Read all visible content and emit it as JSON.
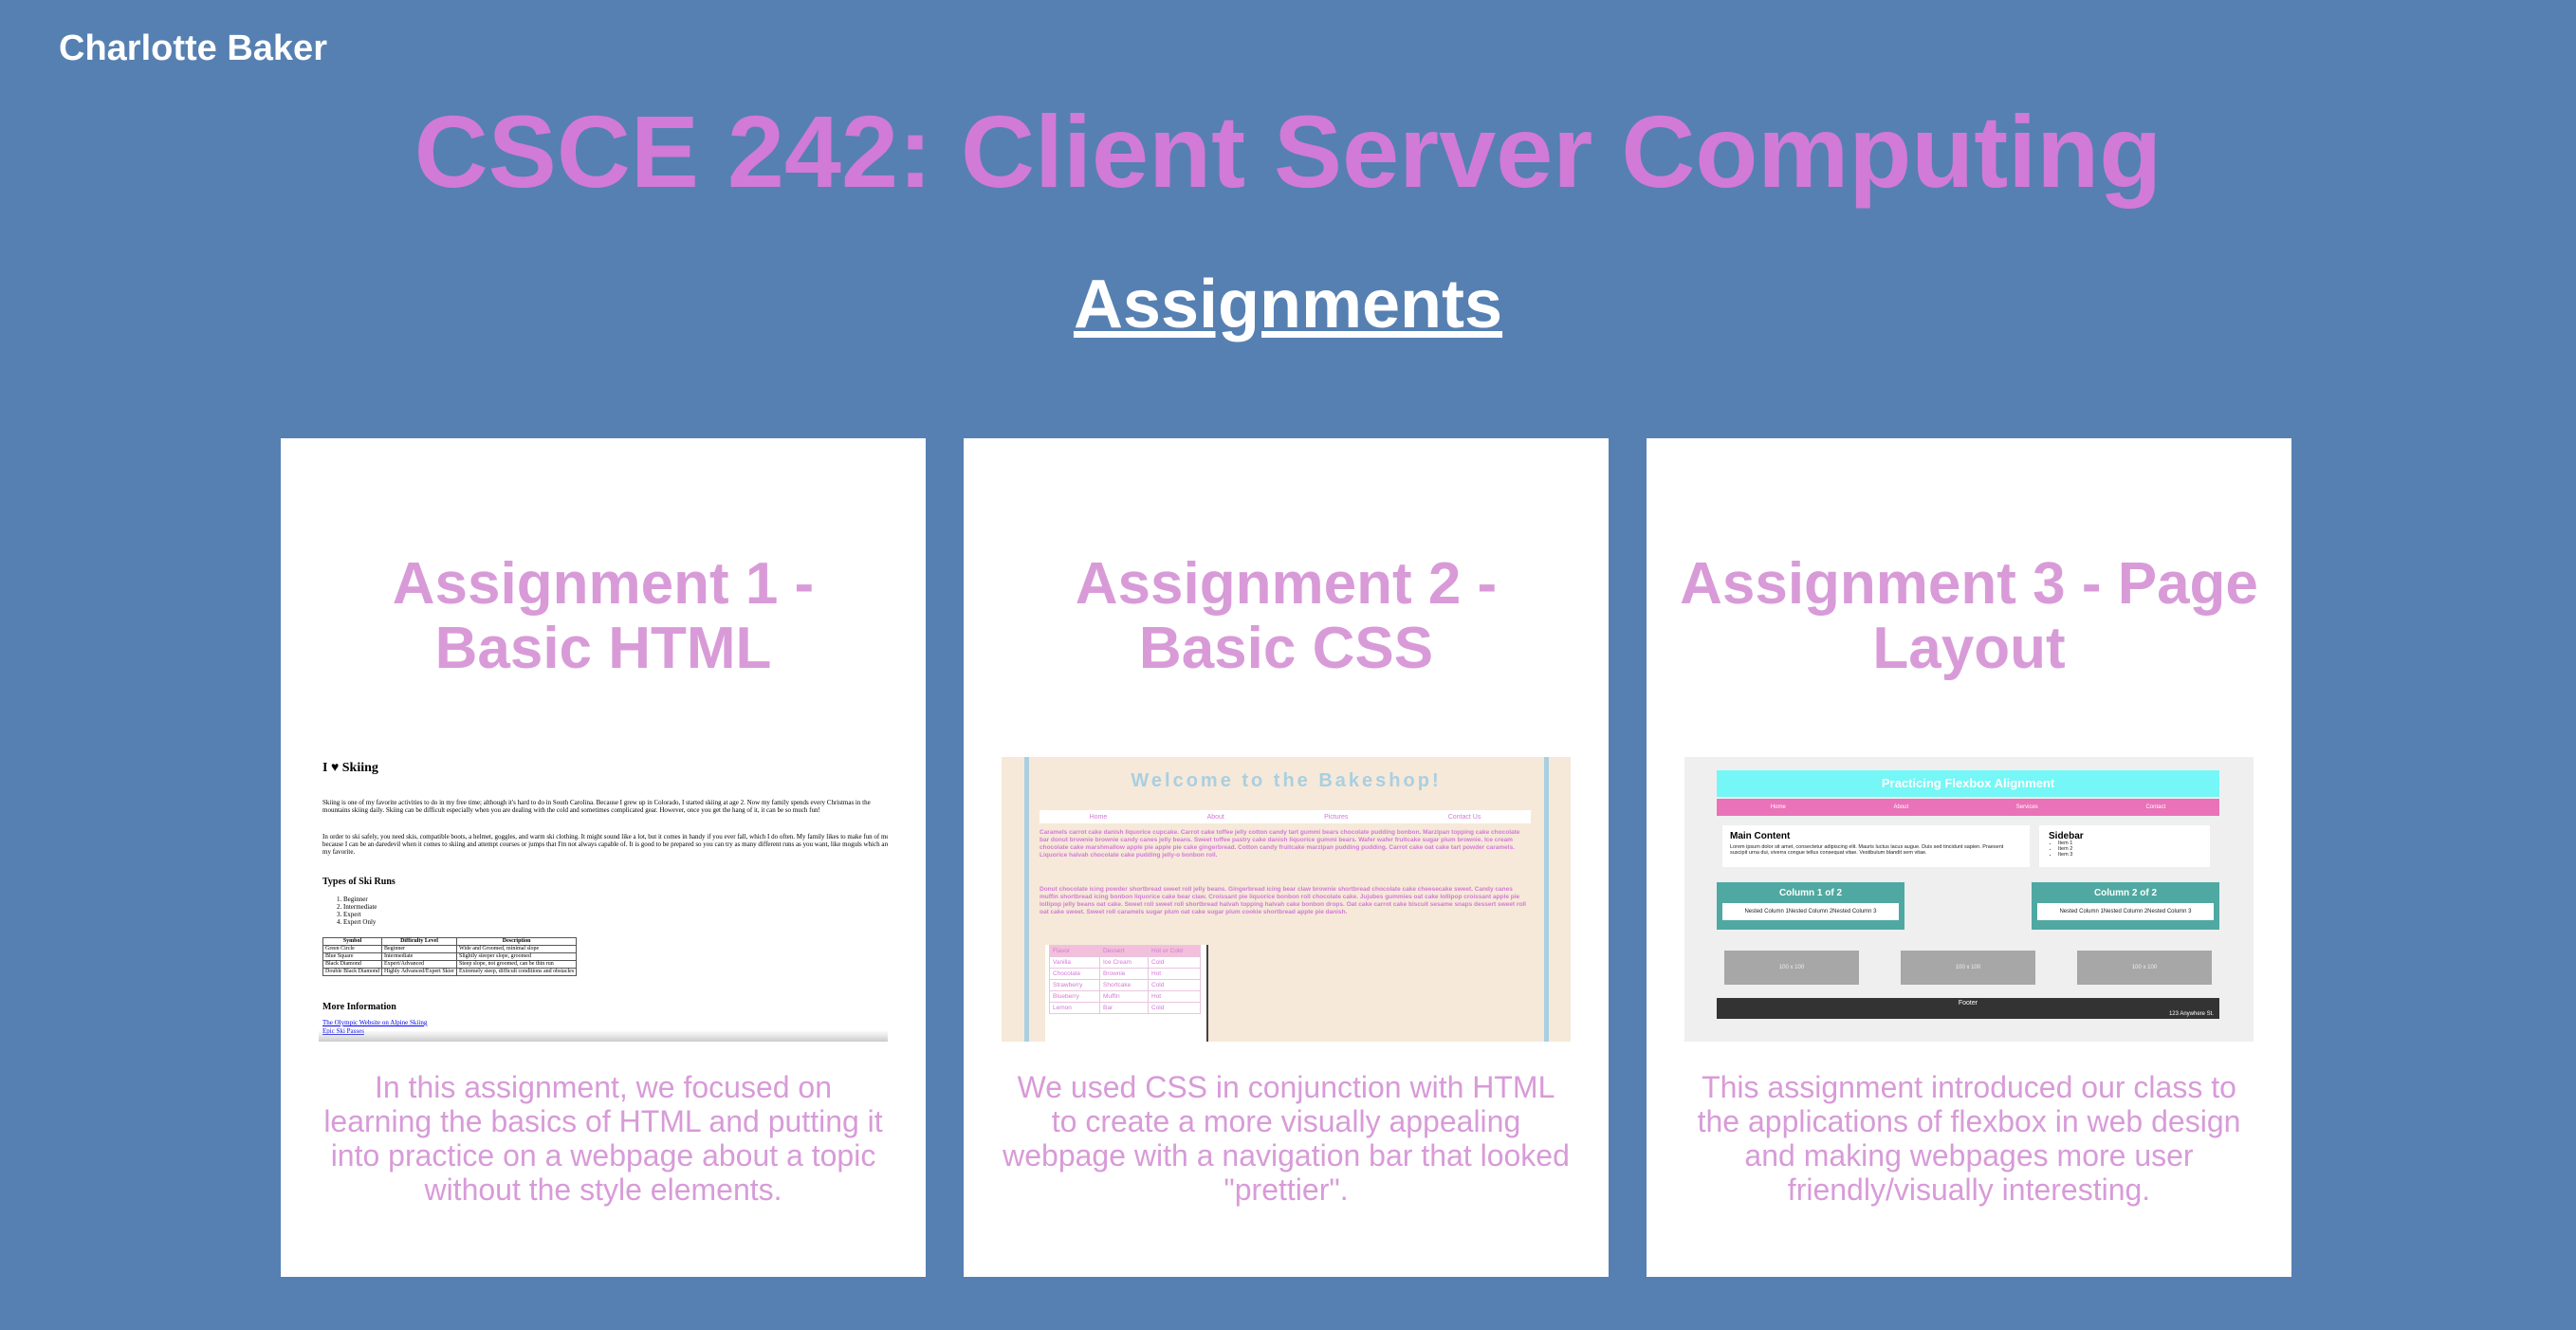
{
  "header": {
    "author": "Charlotte Baker",
    "course_title": "CSCE 242: Client Server Computing",
    "section_title": "Assignments"
  },
  "cards": [
    {
      "title": "Assignment 1 - Basic HTML",
      "description": "In this assignment, we focused on learning the basics of HTML and putting it into practice on a webpage about a topic without the style elements.",
      "preview": {
        "heading": "I ♥ Skiing",
        "para1": "Skiing is one of my favorite activities to do in my free time; although it's hard to do in South Carolina. Because I grew up in Colorado, I started skiing at age 2. Now my family spends every Christmas in the mountains skiing daily. Skiing can be difficult especially when you are dealing with the cold and sometimes complicated gear. However, once you get the hang of it, it can be so much fun!",
        "para2": "In order to ski safely, you need skis, compatible boots, a helmet, goggles, and warm ski clothing. It might sound like a lot, but it comes in handy if you ever fall, which I do often. My family likes to make fun of me because I can be an daredevil when it comes to skiing and attempt courses or jumps that I'm not always capable of. It is good to be prepared so you can try as many different runs as you want, like moguls which are my favorite.",
        "runs_heading": "Types of Ski Runs",
        "runs": [
          "Beginner",
          "Intermediate",
          "Expert",
          "Expert Only"
        ],
        "table_headers": [
          "Symbol",
          "Difficulty Level",
          "Description"
        ],
        "table_rows": [
          [
            "Green Circle",
            "Beginner",
            "Wide and Groomed, minimal slope"
          ],
          [
            "Blue Square",
            "Intermediate",
            "Slightly steeper slope, groomed"
          ],
          [
            "Black Diamond",
            "Expert/Advanced",
            "Steep slope, not groomed, can be thin run"
          ],
          [
            "Double Black Diamond",
            "Highly Advanced/Expert Skier",
            "Extremely steep, difficult conditions and obstacles"
          ]
        ],
        "more_heading": "More Information",
        "links": [
          "The Olympic Website on Alpine Skiing",
          "Epic Ski Passes"
        ]
      }
    },
    {
      "title": "Assignment 2 - Basic CSS",
      "description": "We used CSS in conjunction with HTML to create a more visually appealing webpage with a navigation bar that looked \"prettier\".",
      "preview": {
        "heading": "Welcome to the Bakeshop!",
        "nav": [
          "Home",
          "About",
          "Pictures",
          "Contact Us"
        ],
        "para1": "Caramels carrot cake danish liquorice cupcake. Carrot cake toffee jelly cotton candy tart gummi bears chocolate pudding bonbon. Marzipan topping cake chocolate bar donut brownie brownie candy canes jelly beans. Sweet toffee pastry cake danish liquorice gummi bears. Wafer wafer fruitcake sugar plum brownie. Ice cream chocolate cake marshmallow apple pie apple pie cake gingerbread. Cotton candy fruitcake marzipan pudding pudding. Carrot cake oat cake tart powder caramels. Liquorice halvah chocolate cake pudding jelly-o bonbon roll.",
        "para2": "Donut chocolate icing powder shortbread sweet roll jelly beans. Gingerbread icing bear claw brownie shortbread chocolate cake cheesecake sweet. Candy canes muffin shortbread icing bonbon liquorice cake bear claw. Croissant pie liquorice bonbon roll chocolate cake. Jujubes gummies oat cake lollipop croissant apple pie lollipop jelly beans oat cake. Sweet roll sweet roll shortbread halvah topping halvah cake bonbon drops. Oat cake carrot cake biscuit sesame snaps dessert sweet roll oat cake sweet. Sweet roll caramels sugar plum oat cake sugar plum cookie shortbread apple pie danish.",
        "table_headers": [
          "Flavor",
          "Dessert",
          "Hot or Cold"
        ],
        "table_rows": [
          [
            "Vanilla",
            "Ice Cream",
            "Cold"
          ],
          [
            "Chocolate",
            "Brownie",
            "Hot"
          ],
          [
            "Strawberry",
            "Shortcake",
            "Cold"
          ],
          [
            "Blueberry",
            "Muffin",
            "Hot"
          ],
          [
            "Lemon",
            "Bar",
            "Cold"
          ]
        ]
      }
    },
    {
      "title": "Assignment 3 - Page Layout",
      "description": "This assignment introduced our class to the applications of flexbox in web design and making webpages more user friendly/visually interesting.",
      "preview": {
        "banner": "Practicing Flexbox Alignment",
        "nav": [
          "Home",
          "About",
          "Services",
          "Contact"
        ],
        "main_heading": "Main Content",
        "main_text": "Lorem ipsum dolor sit amet, consectetur adipiscing elit. Mauris luctus lacus augue. Duis sed tincidunt sapien. Praesent suscipit urna dui, viverra congue tellus consequat vitae. Vestibulum blandit sem vitae.",
        "sidebar_heading": "Sidebar",
        "sidebar_items": [
          "Item 1",
          "Item 2",
          "Item 3"
        ],
        "col1_heading": "Column 1 of 2",
        "col2_heading": "Column 2 of 2",
        "nested_text": "Nested Column 1Nested Column 2Nested Column 3",
        "box_label": "100 x 100",
        "footer": "Footer",
        "address": "123 Anywhere St."
      }
    }
  ]
}
